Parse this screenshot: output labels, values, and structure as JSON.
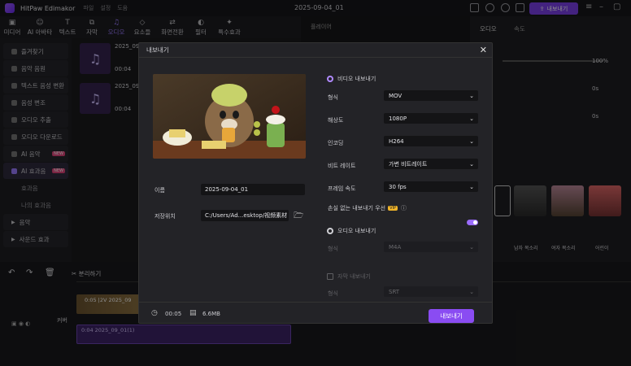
{
  "app": {
    "title": "HitPaw Edimakor",
    "menu": [
      "파일",
      "설정",
      "도움"
    ],
    "project_title": "2025-09-04_01",
    "upgrade": "내보내기"
  },
  "toolbar": [
    {
      "label": "미디어",
      "icon": "folder-icon"
    },
    {
      "label": "AI 아바타",
      "icon": "avatar-icon"
    },
    {
      "label": "텍스트",
      "icon": "text-icon"
    },
    {
      "label": "자막",
      "icon": "subtitle-icon"
    },
    {
      "label": "오디오",
      "icon": "music-icon",
      "active": true
    },
    {
      "label": "요소들",
      "icon": "elements-icon"
    },
    {
      "label": "화면전환",
      "icon": "transition-icon"
    },
    {
      "label": "필터",
      "icon": "filter-icon"
    },
    {
      "label": "특수효과",
      "icon": "effects-icon"
    }
  ],
  "sidebar": [
    {
      "label": "즐겨찾기"
    },
    {
      "label": "음악 음원"
    },
    {
      "label": "텍스트 음성 변환"
    },
    {
      "label": "음성 변조"
    },
    {
      "label": "오디오 추출"
    },
    {
      "label": "오디오 다운로드"
    },
    {
      "label": "AI 음악",
      "badge": "NEW"
    },
    {
      "label": "AI 효과음",
      "badge": "NEW"
    },
    {
      "label": "효과음",
      "sub": true
    },
    {
      "label": "나의 효과음",
      "sub": true
    },
    {
      "label": "음악"
    },
    {
      "label": "사운드 효과"
    }
  ],
  "media_items": [
    {
      "name": "2025_09",
      "duration": "00:04"
    },
    {
      "name": "2025_09",
      "duration": "00:04"
    }
  ],
  "player": {
    "label": "플레이어"
  },
  "right_panel": {
    "tabs": [
      "오디오",
      "속도"
    ],
    "volume": "100%",
    "fade_in": "0s",
    "fade_out": "0s",
    "voices": [
      "남자 목소리",
      "여자 목소리",
      "어린이"
    ],
    "partial": [
      "기",
      "요",
      "",
      "",
      "드"
    ]
  },
  "dialog": {
    "title": "내보내기",
    "name_label": "이름",
    "name_value": "2025-09-04_01",
    "path_label": "저장위치",
    "path_value": "C:/Users/Ad...esktop/视频素材",
    "video_export": "비디오 내보내기",
    "format_label": "형식",
    "format_value": "MOV",
    "resolution_label": "해상도",
    "resolution_value": "1080P",
    "encoding_label": "인코딩",
    "encoding_value": "H264",
    "bitrate_label": "비트 레이트",
    "bitrate_value": "가변 비트레이트",
    "fps_label": "프레임 속도",
    "fps_value": "30  fps",
    "lossless_label": "손실 없는 내보내기 우선",
    "vip": "VIP",
    "audio_export": "오디오 내보내기",
    "audio_format_label": "형식",
    "audio_format_value": "M4A",
    "subtitle_export": "자막 내보내기",
    "subtitle_format_label": "형식",
    "subtitle_format_value": "SRT",
    "duration": "00:05",
    "size": "6.6MB",
    "export_button": "내보내기"
  },
  "timeline": {
    "split": "분리하기",
    "clip_label": "0:05 |2V 2025_09",
    "audio_label": "0:04 2025_09_01(1)",
    "cover": "커버",
    "right_btns": [
      "텍스트 변환",
      "초기화"
    ]
  }
}
